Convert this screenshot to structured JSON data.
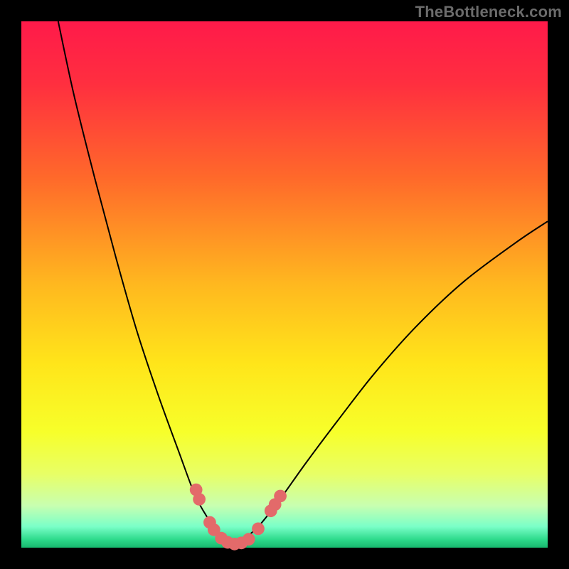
{
  "watermark": {
    "text": "TheBottleneck.com"
  },
  "frame": {
    "border_px": 30,
    "bg_color": "#000000"
  },
  "gradient": {
    "stops": [
      {
        "offset": 0.0,
        "color": "#ff1a4a"
      },
      {
        "offset": 0.12,
        "color": "#ff2f3f"
      },
      {
        "offset": 0.3,
        "color": "#ff6a2a"
      },
      {
        "offset": 0.5,
        "color": "#ffb81f"
      },
      {
        "offset": 0.65,
        "color": "#ffe51a"
      },
      {
        "offset": 0.78,
        "color": "#f7ff2a"
      },
      {
        "offset": 0.86,
        "color": "#e8ff66"
      },
      {
        "offset": 0.92,
        "color": "#c8ffb0"
      },
      {
        "offset": 0.96,
        "color": "#7affc8"
      },
      {
        "offset": 0.985,
        "color": "#2cd98a"
      },
      {
        "offset": 1.0,
        "color": "#18b86e"
      }
    ]
  },
  "chart_data": {
    "type": "line",
    "title": "",
    "xlabel": "",
    "ylabel": "",
    "xlim": [
      0,
      100
    ],
    "ylim": [
      0,
      100
    ],
    "series": [
      {
        "name": "curve-left",
        "x": [
          7.0,
          10.0,
          14.0,
          18.0,
          22.0,
          26.0,
          30.0,
          33.0,
          35.5,
          37.5,
          39.0,
          40.0
        ],
        "y": [
          100.0,
          86.0,
          70.0,
          55.0,
          41.0,
          29.0,
          18.0,
          10.0,
          5.5,
          2.8,
          1.3,
          0.6
        ]
      },
      {
        "name": "curve-right",
        "x": [
          40.0,
          42.0,
          45.0,
          49.0,
          54.0,
          60.0,
          67.0,
          75.0,
          84.0,
          94.0,
          100.0
        ],
        "y": [
          0.6,
          1.5,
          4.0,
          9.0,
          16.0,
          24.0,
          33.0,
          42.0,
          50.5,
          58.0,
          62.0
        ]
      }
    ],
    "markers": {
      "name": "bottleneck-points",
      "color": "#e36a6a",
      "radius_frac": 0.012,
      "points": [
        {
          "x": 33.2,
          "y": 11.0
        },
        {
          "x": 33.8,
          "y": 9.2
        },
        {
          "x": 35.8,
          "y": 4.8
        },
        {
          "x": 36.6,
          "y": 3.4
        },
        {
          "x": 38.0,
          "y": 1.8
        },
        {
          "x": 39.2,
          "y": 1.0
        },
        {
          "x": 40.5,
          "y": 0.7
        },
        {
          "x": 41.8,
          "y": 0.9
        },
        {
          "x": 43.2,
          "y": 1.6
        },
        {
          "x": 45.0,
          "y": 3.6
        },
        {
          "x": 47.4,
          "y": 7.0
        },
        {
          "x": 48.2,
          "y": 8.2
        },
        {
          "x": 49.2,
          "y": 9.8
        }
      ]
    }
  }
}
